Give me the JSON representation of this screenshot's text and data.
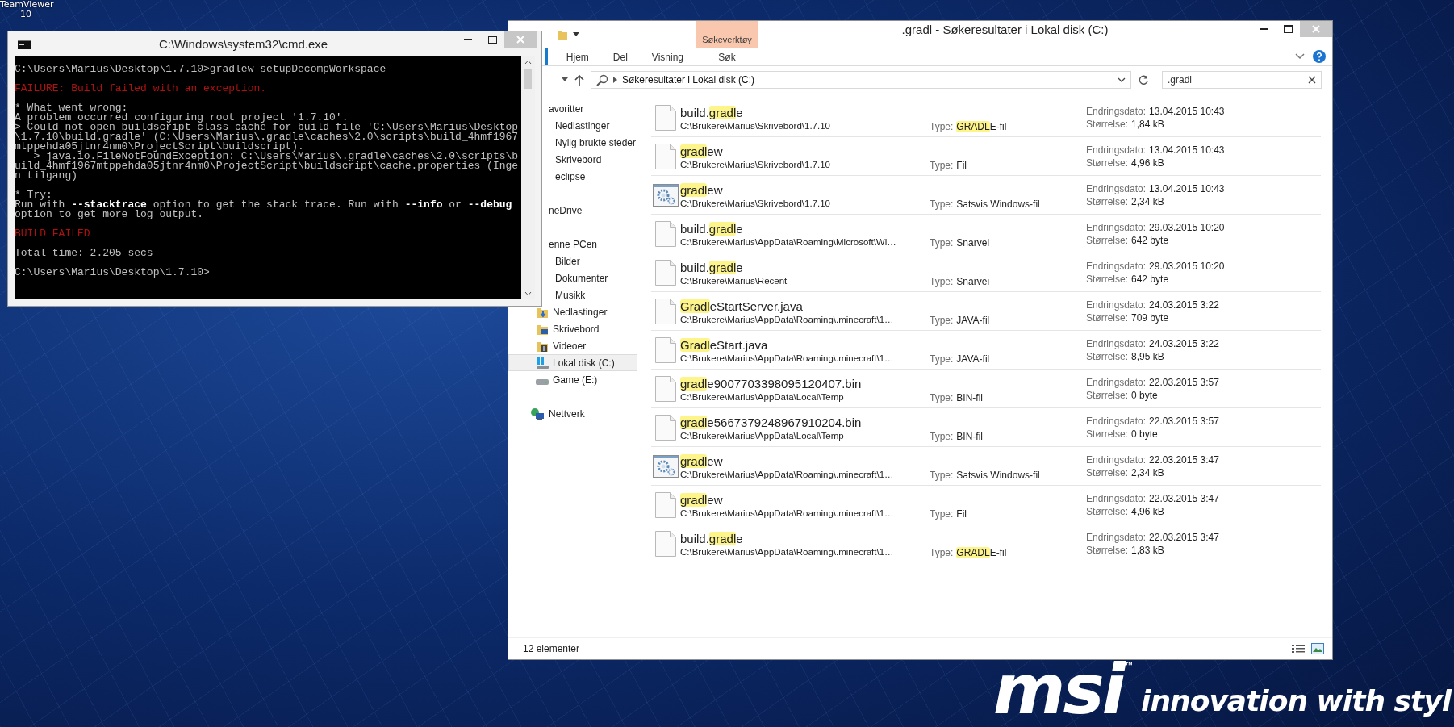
{
  "desktop": {
    "shortcut_label": "TeamViewer 10",
    "wallpaper": {
      "logo": "msi",
      "trademark": "™",
      "slogan": "innovation with styl"
    }
  },
  "cmd": {
    "title": "C:\\Windows\\system32\\cmd.exe",
    "blocks": [
      {
        "kind": "normal",
        "lines": [
          "C:\\Users\\Marius\\Desktop\\1.7.10>gradlew setupDecompWorkspace"
        ]
      },
      {
        "kind": "error",
        "lines": [
          "FAILURE: Build failed with an exception."
        ]
      },
      {
        "kind": "normal",
        "lines": [
          "* What went wrong:",
          "A problem occurred configuring root project '1.7.10'.",
          "> Could not open buildscript class cache for build file 'C:\\Users\\Marius\\Desktop",
          "\\1.7.10\\build.gradle' (C:\\Users\\Marius\\.gradle\\caches\\2.0\\scripts\\build_4hmf1967",
          "mtppehda05jtnr4nm0\\ProjectScript\\buildscript).",
          "   > java.io.FileNotFoundException: C:\\Users\\Marius\\.gradle\\caches\\2.0\\scripts\\b",
          "uild_4hmf1967mtppehda05jtnr4nm0\\ProjectScript\\buildscript\\cache.properties (Inge",
          "n tilgang)"
        ]
      },
      {
        "kind": "normal",
        "lines": [
          "* Try:",
          "Run with **--stacktrace** option to get the stack trace. Run with **--info** or **--debug**",
          "option to get more log output."
        ]
      },
      {
        "kind": "error",
        "lines": [
          "BUILD FAILED"
        ]
      },
      {
        "kind": "normal",
        "lines": [
          "Total time: 2.205 secs"
        ]
      },
      {
        "kind": "normal",
        "lines": [
          "C:\\Users\\Marius\\Desktop\\1.7.10>"
        ]
      }
    ]
  },
  "explorer": {
    "title": ".gradl - Søkeresultater i Lokal disk (C:)",
    "ribbon": {
      "tabs": [
        {
          "label": "Hjem",
          "selected": false
        },
        {
          "label": "Del",
          "selected": false
        },
        {
          "label": "Visning",
          "selected": false
        }
      ],
      "contextual_group": {
        "label": "Søkeverktøy",
        "tabs": [
          {
            "label": "Søk",
            "selected": false
          }
        ]
      }
    },
    "address": "Søkeresultater i Lokal disk (C:)",
    "search": {
      "value": ".gradl"
    },
    "sidebar": {
      "items": [
        {
          "label": "avoritter",
          "kind": "none",
          "selected": false,
          "children": [
            {
              "label": "Nedlastinger",
              "kind": "none",
              "selected": false
            },
            {
              "label": "Nylig brukte steder",
              "kind": "none",
              "selected": false
            },
            {
              "label": "Skrivebord",
              "kind": "none",
              "selected": false
            },
            {
              "label": "eclipse",
              "kind": "none",
              "selected": false
            }
          ]
        },
        {
          "label": "neDrive",
          "kind": "none",
          "selected": false
        },
        {
          "label": "enne PCen",
          "kind": "none",
          "selected": false,
          "children": [
            {
              "label": "Bilder",
              "kind": "none",
              "selected": false
            },
            {
              "label": "Dokumenter",
              "kind": "none",
              "selected": false
            },
            {
              "label": "Musikk",
              "kind": "none",
              "selected": false
            },
            {
              "label": "Nedlastinger",
              "kind": "folder-download",
              "selected": false
            },
            {
              "label": "Skrivebord",
              "kind": "folder-desktop",
              "selected": false
            },
            {
              "label": "Videoer",
              "kind": "folder-video",
              "selected": false
            },
            {
              "label": "Lokal disk (C:)",
              "kind": "drive-system",
              "selected": true
            },
            {
              "label": "Game (E:)",
              "kind": "drive",
              "selected": false
            }
          ]
        },
        {
          "label": "Nettverk",
          "kind": "network",
          "selected": false
        }
      ]
    },
    "results": [
      {
        "kind": "document",
        "name_parts": [
          {
            "text": "build.",
            "match": false
          },
          {
            "text": "gradl",
            "match": true
          },
          {
            "text": "e",
            "match": false
          }
        ],
        "path": "C:\\Brukere\\Marius\\Skrivebord\\1.7.10",
        "type_label": "Type:",
        "type_parts": [
          {
            "text": "GRADL",
            "match": true
          },
          {
            "text": "E-fil",
            "match": false
          }
        ],
        "date_label": "Endringsdato:",
        "date": "13.04.2015 10:43",
        "size_label": "Størrelse:",
        "size": "1,84 kB"
      },
      {
        "kind": "document",
        "name_parts": [
          {
            "text": "gradl",
            "match": true
          },
          {
            "text": "ew",
            "match": false
          }
        ],
        "path": "C:\\Brukere\\Marius\\Skrivebord\\1.7.10",
        "type_label": "Type:",
        "type_parts": [
          {
            "text": "Fil",
            "match": false
          }
        ],
        "date_label": "Endringsdato:",
        "date": "13.04.2015 10:43",
        "size_label": "Størrelse:",
        "size": "4,96 kB"
      },
      {
        "kind": "batch",
        "name_parts": [
          {
            "text": "gradl",
            "match": true
          },
          {
            "text": "ew",
            "match": false
          }
        ],
        "path": "C:\\Brukere\\Marius\\Skrivebord\\1.7.10",
        "type_label": "Type:",
        "type_parts": [
          {
            "text": "Satsvis Windows-fil",
            "match": false
          }
        ],
        "date_label": "Endringsdato:",
        "date": "13.04.2015 10:43",
        "size_label": "Størrelse:",
        "size": "2,34 kB"
      },
      {
        "kind": "document",
        "name_parts": [
          {
            "text": "build.",
            "match": false
          },
          {
            "text": "gradl",
            "match": true
          },
          {
            "text": "e",
            "match": false
          }
        ],
        "path": "C:\\Brukere\\Marius\\AppData\\Roaming\\Microsoft\\Wi…",
        "type_label": "Type:",
        "type_parts": [
          {
            "text": "Snarvei",
            "match": false
          }
        ],
        "date_label": "Endringsdato:",
        "date": "29.03.2015 10:20",
        "size_label": "Størrelse:",
        "size": "642 byte"
      },
      {
        "kind": "document",
        "name_parts": [
          {
            "text": "build.",
            "match": false
          },
          {
            "text": "gradl",
            "match": true
          },
          {
            "text": "e",
            "match": false
          }
        ],
        "path": "C:\\Brukere\\Marius\\Recent",
        "type_label": "Type:",
        "type_parts": [
          {
            "text": "Snarvei",
            "match": false
          }
        ],
        "date_label": "Endringsdato:",
        "date": "29.03.2015 10:20",
        "size_label": "Størrelse:",
        "size": "642 byte"
      },
      {
        "kind": "document",
        "name_parts": [
          {
            "text": "Gradl",
            "match": true
          },
          {
            "text": "eStartServer.java",
            "match": false
          }
        ],
        "path": "C:\\Brukere\\Marius\\AppData\\Roaming\\.minecraft\\1…",
        "type_label": "Type:",
        "type_parts": [
          {
            "text": "JAVA-fil",
            "match": false
          }
        ],
        "date_label": "Endringsdato:",
        "date": "24.03.2015 3:22",
        "size_label": "Størrelse:",
        "size": "709 byte"
      },
      {
        "kind": "document",
        "name_parts": [
          {
            "text": "Gradl",
            "match": true
          },
          {
            "text": "eStart.java",
            "match": false
          }
        ],
        "path": "C:\\Brukere\\Marius\\AppData\\Roaming\\.minecraft\\1…",
        "type_label": "Type:",
        "type_parts": [
          {
            "text": "JAVA-fil",
            "match": false
          }
        ],
        "date_label": "Endringsdato:",
        "date": "24.03.2015 3:22",
        "size_label": "Størrelse:",
        "size": "8,95 kB"
      },
      {
        "kind": "document",
        "name_parts": [
          {
            "text": "gradl",
            "match": true
          },
          {
            "text": "e9007703398095120407.bin",
            "match": false
          }
        ],
        "path": "C:\\Brukere\\Marius\\AppData\\Local\\Temp",
        "type_label": "Type:",
        "type_parts": [
          {
            "text": "BIN-fil",
            "match": false
          }
        ],
        "date_label": "Endringsdato:",
        "date": "22.03.2015 3:57",
        "size_label": "Størrelse:",
        "size": "0 byte"
      },
      {
        "kind": "document",
        "name_parts": [
          {
            "text": "gradl",
            "match": true
          },
          {
            "text": "e5667379248967910204.bin",
            "match": false
          }
        ],
        "path": "C:\\Brukere\\Marius\\AppData\\Local\\Temp",
        "type_label": "Type:",
        "type_parts": [
          {
            "text": "BIN-fil",
            "match": false
          }
        ],
        "date_label": "Endringsdato:",
        "date": "22.03.2015 3:57",
        "size_label": "Størrelse:",
        "size": "0 byte"
      },
      {
        "kind": "batch",
        "name_parts": [
          {
            "text": "gradl",
            "match": true
          },
          {
            "text": "ew",
            "match": false
          }
        ],
        "path": "C:\\Brukere\\Marius\\AppData\\Roaming\\.minecraft\\1…",
        "type_label": "Type:",
        "type_parts": [
          {
            "text": "Satsvis Windows-fil",
            "match": false
          }
        ],
        "date_label": "Endringsdato:",
        "date": "22.03.2015 3:47",
        "size_label": "Størrelse:",
        "size": "2,34 kB"
      },
      {
        "kind": "document",
        "name_parts": [
          {
            "text": "gradl",
            "match": true
          },
          {
            "text": "ew",
            "match": false
          }
        ],
        "path": "C:\\Brukere\\Marius\\AppData\\Roaming\\.minecraft\\1…",
        "type_label": "Type:",
        "type_parts": [
          {
            "text": "Fil",
            "match": false
          }
        ],
        "date_label": "Endringsdato:",
        "date": "22.03.2015 3:47",
        "size_label": "Størrelse:",
        "size": "4,96 kB"
      },
      {
        "kind": "document",
        "name_parts": [
          {
            "text": "build.",
            "match": false
          },
          {
            "text": "gradl",
            "match": true
          },
          {
            "text": "e",
            "match": false
          }
        ],
        "path": "C:\\Brukere\\Marius\\AppData\\Roaming\\.minecraft\\1…",
        "type_label": "Type:",
        "type_parts": [
          {
            "text": "GRADL",
            "match": true
          },
          {
            "text": "E-fil",
            "match": false
          }
        ],
        "date_label": "Endringsdato:",
        "date": "22.03.2015 3:47",
        "size_label": "Størrelse:",
        "size": "1,83 kB"
      }
    ],
    "status_bar": {
      "count": "12 elementer"
    }
  }
}
